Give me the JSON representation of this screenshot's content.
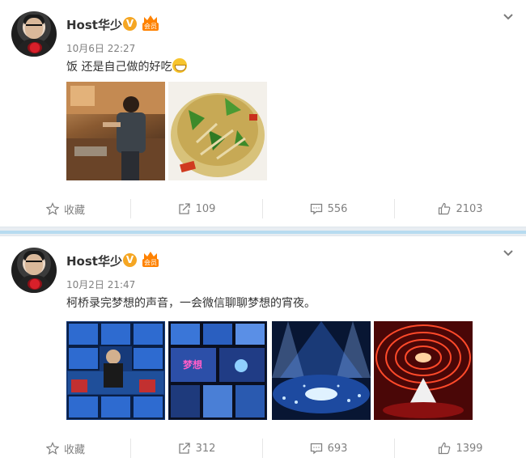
{
  "posts": [
    {
      "author": "Host华少",
      "verified_badge": "V",
      "member_tag": "会员",
      "date": "10月6日",
      "time": "22:27",
      "text": "饭 还是自己做的好吃",
      "emoji": "grin-emoji",
      "images": [
        "cooking-photo",
        "fried-dish-photo"
      ],
      "actions": {
        "favorite_label": "收藏",
        "repost_count": "109",
        "comment_count": "556",
        "like_count": "2103"
      }
    },
    {
      "author": "Host华少",
      "verified_badge": "V",
      "member_tag": "会员",
      "date": "10月2日",
      "time": "21:47",
      "text": "柯桥录完梦想的声音，一会微信聊聊梦想的宵夜。",
      "images": [
        "tv-studio-monitors-photo",
        "broadcast-screens-photo",
        "stage-lights-photo",
        "stage-red-tunnel-photo"
      ],
      "actions": {
        "favorite_label": "收藏",
        "repost_count": "312",
        "comment_count": "693",
        "like_count": "1399"
      }
    }
  ],
  "colors": {
    "verified": "#f5a623",
    "member": "#ff8200",
    "divider": "#b7dbf0",
    "meta_text": "#808080"
  }
}
